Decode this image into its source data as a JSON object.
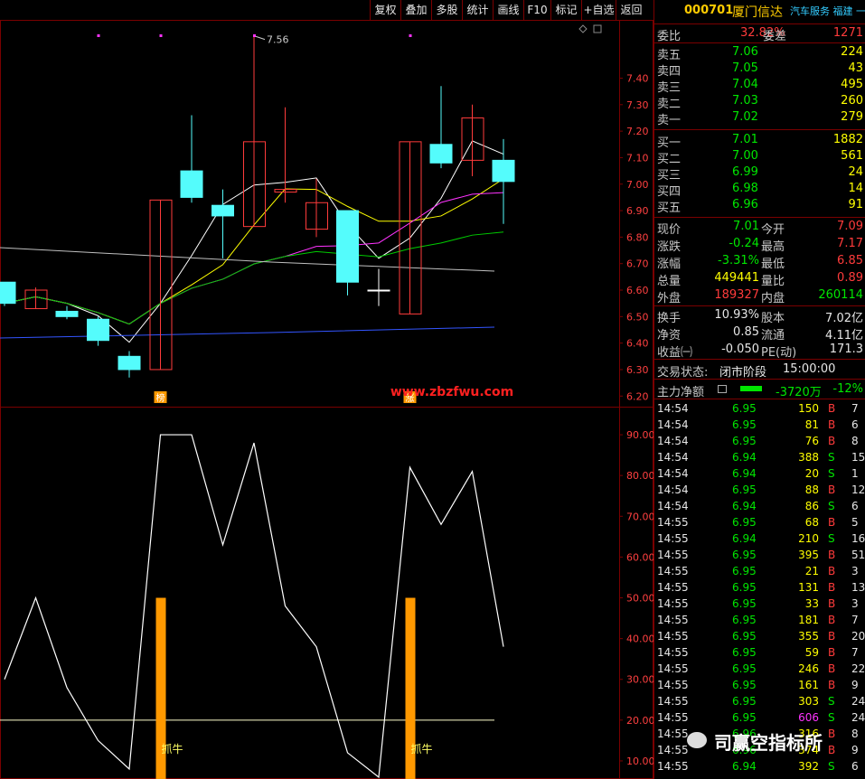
{
  "toolbar": {
    "buttons": [
      "复权",
      "叠加",
      "多股",
      "统计",
      "画线",
      "F10",
      "标记",
      "+自选",
      "返回"
    ]
  },
  "stock": {
    "code": "000701",
    "name": "厦门信达",
    "industry": "汽车服务 福建 一带"
  },
  "weibi": {
    "label1": "委比",
    "value1": "32.82%",
    "label2": "委差",
    "value2": "1271"
  },
  "asks": [
    {
      "label": "卖五",
      "price": "7.06",
      "vol": "224"
    },
    {
      "label": "卖四",
      "price": "7.05",
      "vol": "43"
    },
    {
      "label": "卖三",
      "price": "7.04",
      "vol": "495"
    },
    {
      "label": "卖二",
      "price": "7.03",
      "vol": "260"
    },
    {
      "label": "卖一",
      "price": "7.02",
      "vol": "279"
    }
  ],
  "bids": [
    {
      "label": "买一",
      "price": "7.01",
      "vol": "1882"
    },
    {
      "label": "买二",
      "price": "7.00",
      "vol": "561"
    },
    {
      "label": "买三",
      "price": "6.99",
      "vol": "24"
    },
    {
      "label": "买四",
      "price": "6.98",
      "vol": "14"
    },
    {
      "label": "买五",
      "price": "6.96",
      "vol": "91"
    }
  ],
  "stats": [
    {
      "l1": "现价",
      "v1": "7.01",
      "c1": "green",
      "l2": "今开",
      "v2": "7.09",
      "c2": "red"
    },
    {
      "l1": "涨跌",
      "v1": "-0.24",
      "c1": "green",
      "l2": "最高",
      "v2": "7.17",
      "c2": "red"
    },
    {
      "l1": "涨幅",
      "v1": "-3.31%",
      "c1": "green",
      "l2": "最低",
      "v2": "6.85",
      "c2": "red"
    },
    {
      "l1": "总量",
      "v1": "449441",
      "c1": "yellow",
      "l2": "量比",
      "v2": "0.89",
      "c2": "red"
    },
    {
      "l1": "外盘",
      "v1": "189327",
      "c1": "red",
      "l2": "内盘",
      "v2": "260114",
      "c2": "green"
    }
  ],
  "stats2": [
    {
      "l1": "换手",
      "v1": "10.93%",
      "l2": "股本",
      "v2": "7.02亿"
    },
    {
      "l1": "净资",
      "v1": "0.85",
      "l2": "流通",
      "v2": "4.11亿"
    },
    {
      "l1": "收益㈠",
      "v1": "-0.050",
      "l2": "PE(动)",
      "v2": "171.3"
    }
  ],
  "trade_status": {
    "label": "交易状态:",
    "value": "闭市阶段",
    "time": "15:00:00"
  },
  "main_net": {
    "label": "主力净额",
    "value": "-3720万",
    "pct": "-12%"
  },
  "ticks": [
    {
      "t": "14:54",
      "p": "6.95",
      "v": "150",
      "d": "B",
      "x": "7"
    },
    {
      "t": "14:54",
      "p": "6.95",
      "v": "81",
      "d": "B",
      "x": "6"
    },
    {
      "t": "14:54",
      "p": "6.95",
      "v": "76",
      "d": "B",
      "x": "8"
    },
    {
      "t": "14:54",
      "p": "6.94",
      "v": "388",
      "d": "S",
      "x": "15"
    },
    {
      "t": "14:54",
      "p": "6.94",
      "v": "20",
      "d": "S",
      "x": "1"
    },
    {
      "t": "14:54",
      "p": "6.95",
      "v": "88",
      "d": "B",
      "x": "12"
    },
    {
      "t": "14:54",
      "p": "6.94",
      "v": "86",
      "d": "S",
      "x": "6"
    },
    {
      "t": "14:55",
      "p": "6.95",
      "v": "68",
      "d": "B",
      "x": "5"
    },
    {
      "t": "14:55",
      "p": "6.94",
      "v": "210",
      "d": "S",
      "x": "16"
    },
    {
      "t": "14:55",
      "p": "6.95",
      "v": "395",
      "d": "B",
      "x": "51"
    },
    {
      "t": "14:55",
      "p": "6.95",
      "v": "21",
      "d": "B",
      "x": "3"
    },
    {
      "t": "14:55",
      "p": "6.95",
      "v": "131",
      "d": "B",
      "x": "13"
    },
    {
      "t": "14:55",
      "p": "6.95",
      "v": "33",
      "d": "B",
      "x": "3"
    },
    {
      "t": "14:55",
      "p": "6.95",
      "v": "181",
      "d": "B",
      "x": "7"
    },
    {
      "t": "14:55",
      "p": "6.95",
      "v": "355",
      "d": "B",
      "x": "20"
    },
    {
      "t": "14:55",
      "p": "6.95",
      "v": "59",
      "d": "B",
      "x": "7"
    },
    {
      "t": "14:55",
      "p": "6.95",
      "v": "246",
      "d": "B",
      "x": "22"
    },
    {
      "t": "14:55",
      "p": "6.95",
      "v": "161",
      "d": "B",
      "x": "9"
    },
    {
      "t": "14:55",
      "p": "6.95",
      "v": "303",
      "d": "S",
      "x": "24"
    },
    {
      "t": "14:55",
      "p": "6.95",
      "v": "606",
      "d": "S",
      "x": "24"
    },
    {
      "t": "14:55",
      "p": "6.96",
      "v": "316",
      "d": "B",
      "x": "8"
    },
    {
      "t": "14:55",
      "p": "6.96",
      "v": "374",
      "d": "B",
      "x": "9"
    },
    {
      "t": "14:55",
      "p": "6.94",
      "v": "392",
      "d": "S",
      "x": "6"
    }
  ],
  "watermark": {
    "site": "www.zbzfwu.com",
    "brand": "司赢空指标所"
  },
  "chart_data": [
    {
      "type": "candlestick",
      "ylim": [
        6.16,
        7.62
      ],
      "y_ticks": [
        "7.40",
        "7.30",
        "7.20",
        "7.10",
        "7.00",
        "6.90",
        "6.80",
        "6.70",
        "6.60",
        "6.50",
        "6.40",
        "6.30",
        "6.20"
      ],
      "annotation_high": "7.56",
      "markers": [
        "榜",
        "涨"
      ],
      "candles": [
        {
          "o": 6.63,
          "c": 6.55,
          "h": 6.63,
          "l": 6.54,
          "color": "cyan"
        },
        {
          "o": 6.53,
          "c": 6.6,
          "h": 6.61,
          "l": 6.53,
          "color": "red"
        },
        {
          "o": 6.52,
          "c": 6.5,
          "h": 6.54,
          "l": 6.49,
          "color": "cyan"
        },
        {
          "o": 6.49,
          "c": 6.41,
          "h": 6.5,
          "l": 6.39,
          "color": "cyan"
        },
        {
          "o": 6.35,
          "c": 6.3,
          "h": 6.37,
          "l": 6.27,
          "color": "cyan"
        },
        {
          "o": 6.3,
          "c": 6.94,
          "h": 6.94,
          "l": 6.3,
          "color": "red"
        },
        {
          "o": 7.05,
          "c": 6.95,
          "h": 7.26,
          "l": 6.93,
          "color": "cyan"
        },
        {
          "o": 6.92,
          "c": 6.88,
          "h": 6.98,
          "l": 6.72,
          "color": "cyan"
        },
        {
          "o": 6.84,
          "c": 7.16,
          "h": 7.56,
          "l": 6.84,
          "color": "red"
        },
        {
          "o": 6.97,
          "c": 6.98,
          "h": 7.29,
          "l": 6.93,
          "color": "red"
        },
        {
          "o": 6.83,
          "c": 6.93,
          "h": 7.02,
          "l": 6.8,
          "color": "red"
        },
        {
          "o": 6.9,
          "c": 6.63,
          "h": 6.9,
          "l": 6.58,
          "color": "cyan"
        },
        {
          "o": 6.6,
          "c": 6.6,
          "h": 6.68,
          "l": 6.54,
          "color": "white"
        },
        {
          "o": 6.51,
          "c": 7.16,
          "h": 7.16,
          "l": 6.51,
          "color": "red"
        },
        {
          "o": 7.15,
          "c": 7.08,
          "h": 7.37,
          "l": 7.06,
          "color": "cyan"
        },
        {
          "o": 7.09,
          "c": 7.25,
          "h": 7.3,
          "l": 7.03,
          "color": "red"
        },
        {
          "o": 7.09,
          "c": 7.01,
          "h": 7.17,
          "l": 6.85,
          "color": "cyan"
        }
      ]
    },
    {
      "type": "line",
      "ylim": [
        6,
        96
      ],
      "y_ticks": [
        "90.00",
        "80.00",
        "70.00",
        "60.00",
        "50.00",
        "40.00",
        "30.00",
        "20.00",
        "10.00"
      ],
      "series": [
        {
          "values": [
            30,
            50,
            28,
            15,
            8,
            90,
            90,
            63,
            88,
            48,
            38,
            12,
            6,
            82,
            68,
            81,
            38
          ]
        }
      ],
      "reference_line": 20,
      "signal_bars": [
        {
          "index": 5,
          "value": 50,
          "label": "抓牛"
        },
        {
          "index": 13,
          "value": 50,
          "label": "抓牛"
        }
      ]
    }
  ],
  "colors": {
    "red": "#ff3b3b",
    "cyan": "#54fcfc",
    "green": "#00e600",
    "yellow": "#ffff00",
    "border": "#7a0000",
    "orange": "#ff9900"
  }
}
